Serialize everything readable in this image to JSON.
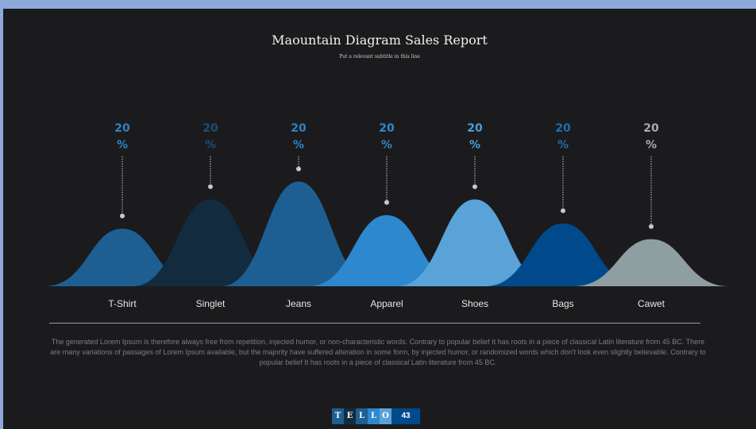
{
  "slide": {
    "title": "Maountain Diagram Sales Report",
    "subtitle": "Put a relevant subtitle in this line",
    "body": "The generated Lorem Ipsum is therefore always free from repetition, injected humor, or non-characteristic words. Contrary to popular belief It has roots in a piece of classical Latin literature from 45 BC. There are many variations of passages of Lorem Ipsum available, but the majority have suffered alteration in some form, by injected humor, or randomized words which don't look even slightly believable. Contrary to popular belief It has roots in a piece of classical Latin literature from 45 BC."
  },
  "footer": {
    "letters": [
      {
        "char": "T",
        "color": "#1d5f92"
      },
      {
        "char": "E",
        "color": "#122b3f"
      },
      {
        "char": "L",
        "color": "#1d5f92"
      },
      {
        "char": "L",
        "color": "#2e88cd"
      },
      {
        "char": "O",
        "color": "#5aa3d8"
      }
    ],
    "page_number": "43"
  },
  "chart_data": {
    "type": "area",
    "categories": [
      "T-Shirt",
      "Singlet",
      "Jeans",
      "Apparel",
      "Shoes",
      "Bags",
      "Cawet"
    ],
    "values": [
      55,
      83,
      100,
      68,
      83,
      60,
      45
    ],
    "data_labels": [
      "20 %",
      "20 %",
      "20 %",
      "20 %",
      "20 %",
      "20 %",
      "20 %"
    ],
    "colors": [
      "#1d5f92",
      "#122b3f",
      "#1d5f92",
      "#2e88cd",
      "#5aa3d8",
      "#004a8c",
      "#8f9ea1"
    ],
    "label_colors": [
      "#2e84c4",
      "#1e4d74",
      "#2e84c4",
      "#2e88cd",
      "#4d9dd8",
      "#1e6db0",
      "#a7adb0"
    ],
    "legend": "none",
    "grid": false
  }
}
